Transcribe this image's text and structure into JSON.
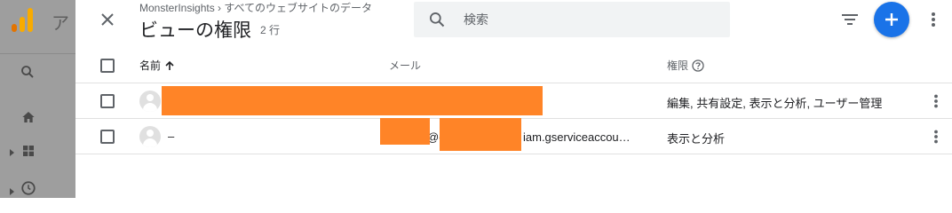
{
  "background_app": {
    "title_partial": "ア"
  },
  "panel": {
    "breadcrumb": "MonsterInsights › すべてのウェブサイトのデータ",
    "title": "ビューの権限",
    "row_count": "2 行",
    "search": {
      "placeholder": "検索"
    }
  },
  "table": {
    "headers": {
      "name": "名前",
      "email": "メール",
      "permissions": "権限"
    },
    "sort": {
      "column": "name",
      "direction": "ascending"
    },
    "rows": [
      {
        "name": "",
        "email": "",
        "permissions": "編集, 共有設定, 表示と分析, ユーザー管理",
        "redacted": true
      },
      {
        "name": "–",
        "email_visible": "@c",
        "email_domain": "iam.gserviceaccou…",
        "permissions": "表示と分析",
        "redacted": true
      }
    ]
  },
  "colors": {
    "accent": "#1a73e8",
    "redaction": "#ff8427",
    "overlay": "#9e9e9e",
    "logo_orange": "#f9ab00",
    "logo_dark": "#e37400"
  },
  "icons": [
    "close-icon",
    "search-icon",
    "filter-icon",
    "add-icon",
    "more-vert-icon",
    "arrow-upward-icon",
    "help-outline-icon",
    "person-icon",
    "home-icon",
    "dashboard-icon",
    "clock-icon"
  ]
}
